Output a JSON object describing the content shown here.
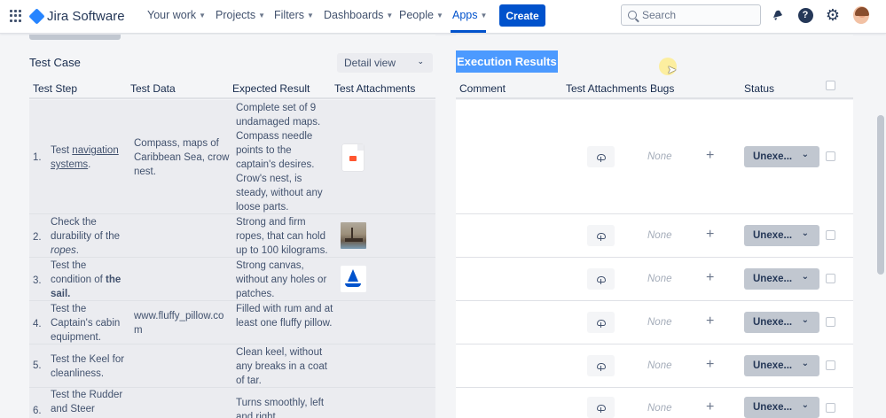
{
  "nav": {
    "product": "Jira Software",
    "items": [
      {
        "label": "Your work"
      },
      {
        "label": "Projects"
      },
      {
        "label": "Filters"
      },
      {
        "label": "Dashboards"
      },
      {
        "label": "People"
      },
      {
        "label": "Apps"
      }
    ],
    "active_item": "Apps",
    "create_label": "Create",
    "search_placeholder": "Search"
  },
  "test_case": {
    "title": "Test Case",
    "view_select": "Detail view",
    "columns": [
      "Test Step",
      "Test Data",
      "Expected Result",
      "Test Attachments"
    ],
    "rows": [
      {
        "num": "1.",
        "step_pre": "Test ",
        "step_link": "navigation systems",
        "step_post": ".",
        "data": "Compass, maps of Caribbean Sea, crow nest.",
        "expected": "Complete set of 9 undamaged maps. Compass needle points to the captain's desires. Crow's nest, is steady, without any loose parts.",
        "attachment": "document-icon"
      },
      {
        "num": "2.",
        "step_pre": "Check the durability of the ",
        "step_em": "ropes",
        "step_post": ".",
        "data": "",
        "expected": "Strong and firm ropes, that can hold up to 100 kilograms.",
        "attachment": "ship-photo"
      },
      {
        "num": "3.",
        "step_pre": "Test the condition of ",
        "step_bold": "the sail.",
        "data": "",
        "expected": "Strong canvas, without any holes or patches.",
        "attachment": "sailboat-icon"
      },
      {
        "num": "4.",
        "step": "Test the Captain's cabin equipment.",
        "data": "www.fluffy_pillow.com",
        "expected": "Filled with rum and at least one fluffy pillow.",
        "attachment": ""
      },
      {
        "num": "5.",
        "step": "Test the Keel for cleanliness.",
        "data": "",
        "expected": "Clean keel, without any breaks in a coat of tar.",
        "attachment": ""
      },
      {
        "num": "6.",
        "step": "Test the Rudder and Steer",
        "data": "",
        "expected": "Turns smoothly, left and right",
        "attachment": ""
      }
    ]
  },
  "execution": {
    "title": "Execution Results",
    "columns": [
      "Comment",
      "Test Attachments",
      "Bugs",
      "Status"
    ],
    "rows": [
      {
        "bugs": "None",
        "status": "Unexe..."
      },
      {
        "bugs": "None",
        "status": "Unexe..."
      },
      {
        "bugs": "None",
        "status": "Unexe..."
      },
      {
        "bugs": "None",
        "status": "Unexe..."
      },
      {
        "bugs": "None",
        "status": "Unexe..."
      },
      {
        "bugs": "None",
        "status": "Unexe..."
      }
    ]
  },
  "colors": {
    "brand": "#0052cc",
    "exec_title_bg": "#4c9aff",
    "status_bg": "#c1c7d0"
  }
}
